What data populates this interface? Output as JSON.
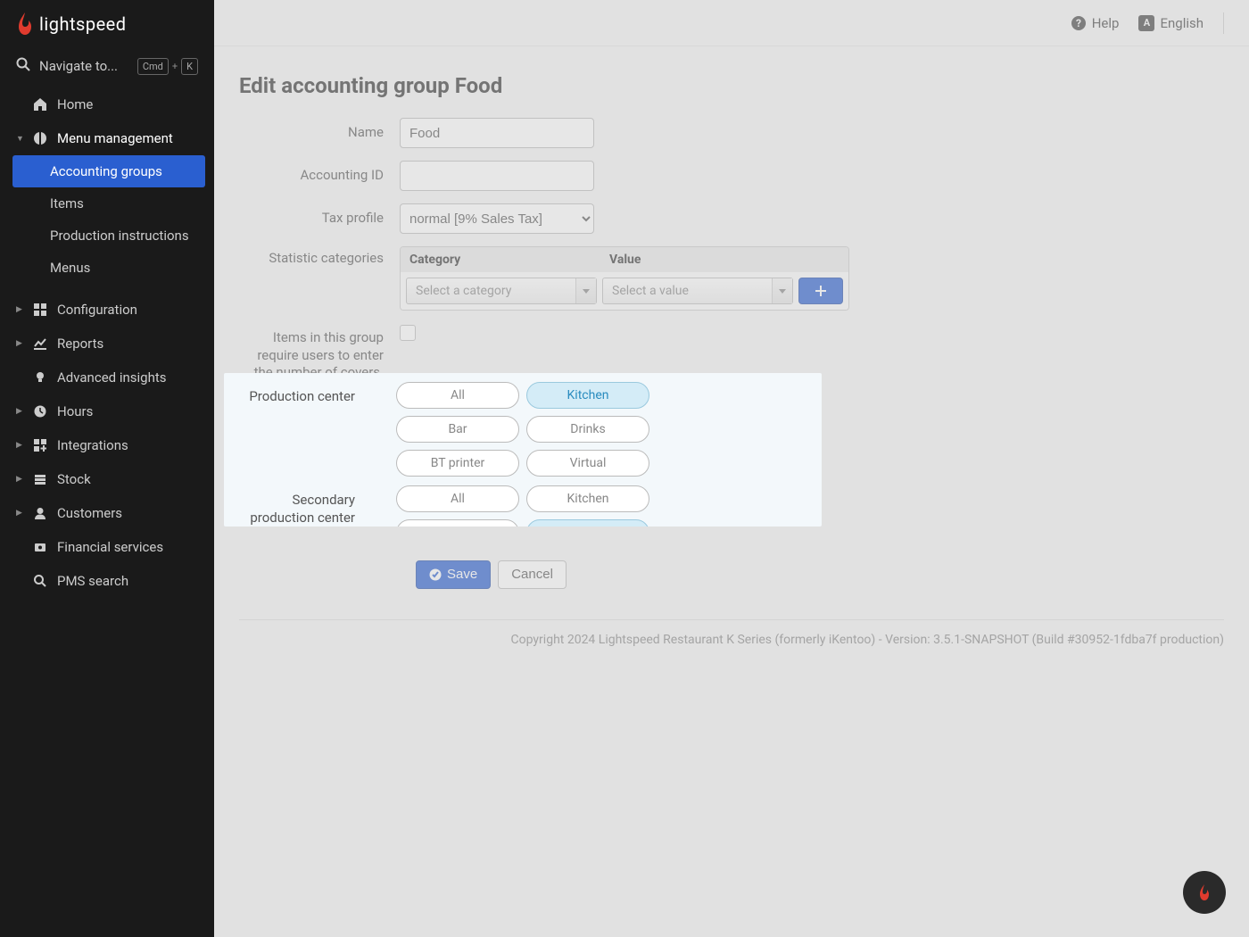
{
  "brand": "lightspeed",
  "search": {
    "label": "Navigate to...",
    "kbd1": "Cmd",
    "kbd2": "K"
  },
  "sidebar": {
    "home": "Home",
    "menu_mgmt": "Menu management",
    "sub": {
      "accounting_groups": "Accounting groups",
      "items": "Items",
      "production_instructions": "Production instructions",
      "menus": "Menus"
    },
    "configuration": "Configuration",
    "reports": "Reports",
    "advanced_insights": "Advanced insights",
    "hours": "Hours",
    "integrations": "Integrations",
    "stock": "Stock",
    "customers": "Customers",
    "financial_services": "Financial services",
    "pms_search": "PMS search"
  },
  "topbar": {
    "help": "Help",
    "lang": "English"
  },
  "page": {
    "title": "Edit accounting group Food",
    "labels": {
      "name": "Name",
      "accounting_id": "Accounting ID",
      "tax_profile": "Tax profile",
      "stat_categories": "Statistic categories",
      "stat_col_cat": "Category",
      "stat_col_val": "Value",
      "stat_cat_ph": "Select a category",
      "stat_val_ph": "Select a value",
      "covers": "Items in this group require users to enter the number of covers.",
      "prod_center": "Production center",
      "sec_prod_center": "Secondary production center"
    },
    "values": {
      "name": "Food",
      "accounting_id": "",
      "tax_profile": "normal [9% Sales Tax]"
    },
    "pills": [
      "All",
      "Kitchen",
      "Bar",
      "Drinks",
      "BT printer",
      "Virtual"
    ],
    "prod_selected": "Kitchen",
    "sec_selected": "Drinks",
    "buttons": {
      "save": "Save",
      "cancel": "Cancel"
    },
    "footer": "Copyright 2024 Lightspeed Restaurant K Series (formerly iKentoo) - Version: 3.5.1-SNAPSHOT (Build #30952-1fdba7f production)"
  }
}
